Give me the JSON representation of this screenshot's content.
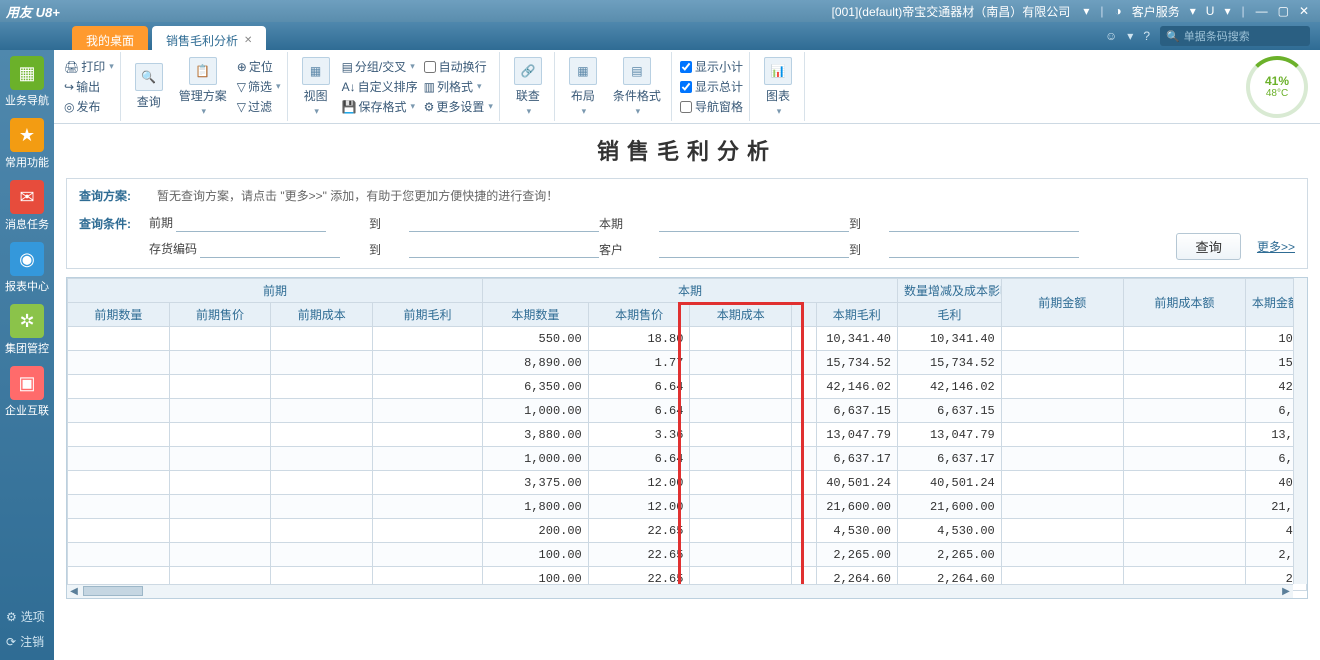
{
  "titlebar": {
    "logo": "用友 U8+",
    "company": "[001](default)帝宝交通器材（南昌）有限公司",
    "service": "客户服务",
    "u_label": "U"
  },
  "tabs": {
    "home": "我的桌面",
    "active": "销售毛利分析"
  },
  "header_right": {
    "search_placeholder": "单据条码搜索"
  },
  "sidebar": {
    "items": [
      {
        "label": "业务导航"
      },
      {
        "label": "常用功能"
      },
      {
        "label": "消息任务"
      },
      {
        "label": "报表中心"
      },
      {
        "label": "集团管控"
      },
      {
        "label": "企业互联"
      }
    ],
    "option": "选项",
    "logout": "注销"
  },
  "ribbon": {
    "print": "打印",
    "output": "输出",
    "publish": "发布",
    "query": "查询",
    "mgmt": "管理方案",
    "locate": "定位",
    "filter": "筛选",
    "exclude": "过滤",
    "view": "视图",
    "group_cross": "分组/交叉",
    "custom_sort": "自定义排序",
    "save_fmt": "保存格式",
    "auto_wrap": "自动换行",
    "col_fmt": "列格式",
    "more_set": "更多设置",
    "link": "联查",
    "layout": "布局",
    "cond_fmt": "条件格式",
    "show_subtotal": "显示小计",
    "show_total": "显示总计",
    "nav_pane": "导航窗格",
    "chart": "图表",
    "gauge_pct": "41%",
    "gauge_temp": "48°C"
  },
  "report": {
    "title": "销售毛利分析",
    "query_plan_label": "查询方案:",
    "query_plan_hint": "暂无查询方案，请点击 \"更多>>\" 添加，有助于您更加方便快捷的进行查询！",
    "query_cond_label": "查询条件:",
    "f_prev": "前期",
    "f_to": "到",
    "f_curr": "本期",
    "f_stock": "存货编码",
    "f_cust": "客户",
    "btn_query": "查询",
    "more": "更多>>",
    "headers_top": [
      "前期",
      "本期",
      "数量增减及成本影响",
      "前期金额",
      "前期成本额",
      "本期金额"
    ],
    "headers": [
      "前期数量",
      "前期售价",
      "前期成本",
      "前期毛利",
      "本期数量",
      "本期售价",
      "本期成本",
      "",
      "本期毛利",
      "毛利"
    ],
    "rows": [
      {
        "c4": "550.00",
        "c5": "18.80",
        "c8": "10,341.40",
        "c9": "10,341.40",
        "c12": "10,"
      },
      {
        "c4": "8,890.00",
        "c5": "1.77",
        "c8": "15,734.52",
        "c9": "15,734.52",
        "c12": "15,"
      },
      {
        "c4": "6,350.00",
        "c5": "6.64",
        "c8": "42,146.02",
        "c9": "42,146.02",
        "c12": "42,"
      },
      {
        "c4": "1,000.00",
        "c5": "6.64",
        "c8": "6,637.15",
        "c9": "6,637.15",
        "c12": "6,6"
      },
      {
        "c4": "3,880.00",
        "c5": "3.36",
        "c8": "13,047.79",
        "c9": "13,047.79",
        "c12": "13,0"
      },
      {
        "c4": "1,000.00",
        "c5": "6.64",
        "c8": "6,637.17",
        "c9": "6,637.17",
        "c12": "6,6"
      },
      {
        "c4": "3,375.00",
        "c5": "12.00",
        "c8": "40,501.24",
        "c9": "40,501.24",
        "c12": "40,"
      },
      {
        "c4": "1,800.00",
        "c5": "12.00",
        "c8": "21,600.00",
        "c9": "21,600.00",
        "c12": "21,6"
      },
      {
        "c4": "200.00",
        "c5": "22.65",
        "c8": "4,530.00",
        "c9": "4,530.00",
        "c12": "4,"
      },
      {
        "c4": "100.00",
        "c5": "22.65",
        "c8": "2,265.00",
        "c9": "2,265.00",
        "c12": "2,2"
      },
      {
        "c4": "100.00",
        "c5": "22.65",
        "c8": "2,264.60",
        "c9": "2,264.60",
        "c12": "2,"
      }
    ]
  }
}
